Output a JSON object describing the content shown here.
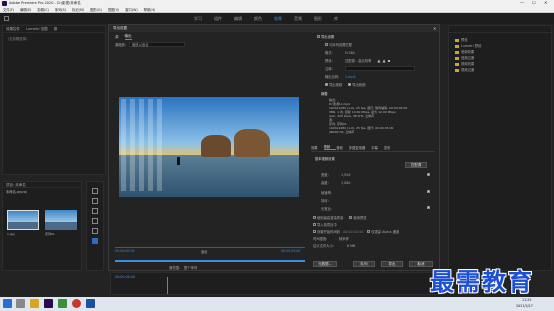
{
  "window": {
    "title": "Adobe Premiere Pro 2020 - D:\\影视\\未命名",
    "controls": [
      "—",
      "☐",
      "✕"
    ]
  },
  "menu": [
    "文件(F)",
    "编辑(E)",
    "剪辑(C)",
    "序列(S)",
    "标记(M)",
    "图形(G)",
    "视图(V)",
    "窗口(W)",
    "帮助(H)"
  ],
  "workspaces": [
    {
      "label": "学习",
      "active": false
    },
    {
      "label": "组件",
      "active": false
    },
    {
      "label": "编辑",
      "active": false
    },
    {
      "label": "颜色",
      "active": false
    },
    {
      "label": "效果",
      "active": true
    },
    {
      "label": "音频",
      "active": false
    },
    {
      "label": "图形",
      "active": false
    },
    {
      "label": "库",
      "active": false
    }
  ],
  "left_panel": {
    "tabs": [
      "效果控件",
      "Lumetri 范围",
      "源",
      "音频剪辑混合器"
    ],
    "content": "（无剪辑选择）"
  },
  "project_panel": {
    "tab": "项目: 未命名",
    "file": "未命名.prproj",
    "clips": [
      {
        "label": "1.jpg"
      },
      {
        "label": "序列01"
      }
    ]
  },
  "right_panel": {
    "items": [
      {
        "label": "预设"
      },
      {
        "label": "Lumetri 预设"
      },
      {
        "label": "音频效果"
      },
      {
        "label": "音频过渡"
      },
      {
        "label": "视频效果"
      },
      {
        "label": "视频过渡"
      }
    ]
  },
  "dialog": {
    "title": "导出设置",
    "tabs": [
      "源",
      "输出"
    ],
    "source_scaling_label": "源缩放:",
    "source_scaling_value": "缩放以适合",
    "preview_timecode_start": "00:00:00:00",
    "preview_timecode_end": "00:00:05:00",
    "fit_label": "适合",
    "range_label": "源范围:",
    "range_value": "整个序列",
    "export_settings": {
      "header": "导出设置",
      "match_seq_label": "与序列设置匹配",
      "format_label": "格式:",
      "format_value": "H.264",
      "preset_label": "预设:",
      "preset_value": "匹配源 - 高比特率",
      "comments_label": "注释:",
      "output_name_label": "输出名称:",
      "output_name_value": "1.mp4",
      "export_video": "导出视频",
      "export_audio": "导出音频",
      "summary_header": "摘要",
      "summary_output_label": "输出:",
      "summary_output_lines": [
        "D:\\影视\\1.mp4",
        "1920x1080 (1.0), 25 fps, 逐行, 软件编码, 00:00:05:00",
        "VBR, 1 次, 目标 10.00 Mbps, 最大 12.00 Mbps",
        "AAC, 320 kbps, 48 kHz, 立体声"
      ],
      "summary_source_label": "源:",
      "summary_source_lines": [
        "序列, 序列01",
        "1920x1080 (1.0), 25 fps, 逐行, 00:00:05:00",
        "48000 Hz, 立体声"
      ]
    },
    "settings_tabs": [
      "效果",
      "视频",
      "音频",
      "多路复用器",
      "字幕",
      "发布"
    ],
    "basic_video": {
      "header": "基本视频设置",
      "match_source_button": "匹配源",
      "width_label": "宽度:",
      "width_value": "1,920",
      "height_label": "高度:",
      "height_value": "1,080",
      "frame_rate_label": "帧速率:",
      "field_order_label": "场序:",
      "aspect_label": "长宽比:"
    },
    "options": {
      "max_render": "使用最高渲染质量",
      "use_previews": "使用预览",
      "import_project": "导入到项目中",
      "set_start_tc": "设置开始时间码",
      "start_tc_value": "00:00:00:00",
      "render_alpha": "仅渲染 Alpha 通道",
      "interp_label": "时间插值:",
      "interp_value": "帧采样",
      "file_size_label": "估计文件大小:",
      "file_size_value": "6 MB"
    },
    "buttons": {
      "metadata": "元数据...",
      "queue": "队列",
      "export": "导出",
      "cancel": "取消"
    }
  },
  "timeline": {
    "timecode": "00:00:00:00"
  },
  "taskbar": {
    "time": "11:25",
    "date": "2021/5/17"
  },
  "watermark": "最需教育"
}
